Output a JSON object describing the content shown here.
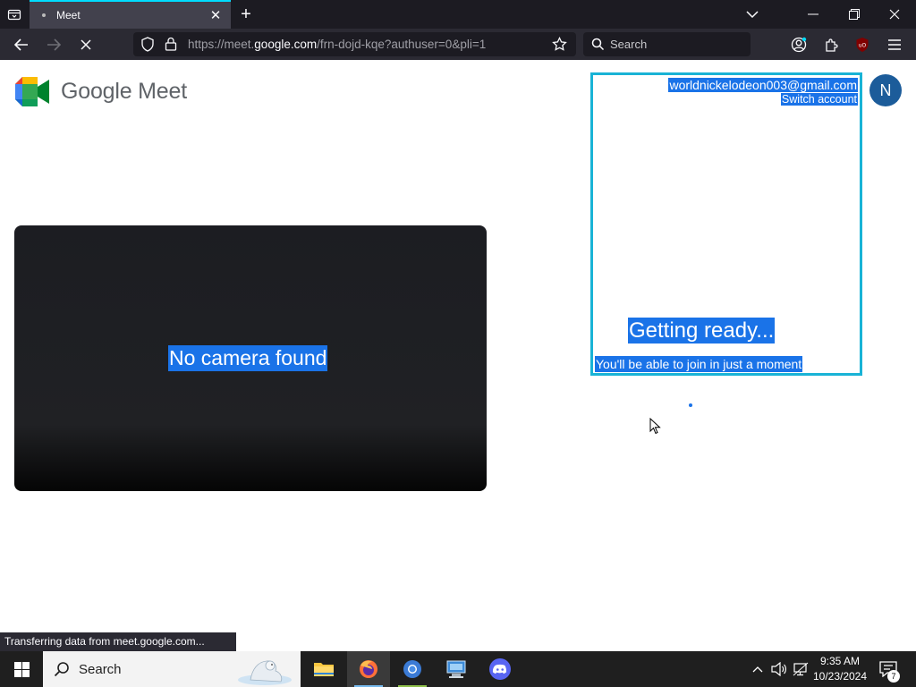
{
  "browser": {
    "tab": {
      "title": "Meet"
    },
    "url": {
      "prefix": "https://meet.",
      "domain": "google.com",
      "path": "/frn-dojd-kqe?authuser=0&pli=1"
    },
    "search": {
      "placeholder": "Search"
    }
  },
  "page": {
    "brand": "Google Meet",
    "preview": {
      "message": "No camera found"
    },
    "account": {
      "email": "worldnickelodeon003@gmail.com",
      "switch_label": "Switch account",
      "avatar_initial": "N"
    },
    "join": {
      "heading": "Getting ready...",
      "subtext": "You'll be able to join in just a moment"
    }
  },
  "status_bar": {
    "text": "Transferring data from meet.google.com..."
  },
  "taskbar": {
    "search_label": "Search",
    "clock": {
      "time": "9:35 AM",
      "date": "10/23/2024"
    },
    "notification_count": "7"
  },
  "colors": {
    "accent": "#1a73e8",
    "panel_border": "#19b3d6",
    "tab_accent": "#00ddff"
  }
}
